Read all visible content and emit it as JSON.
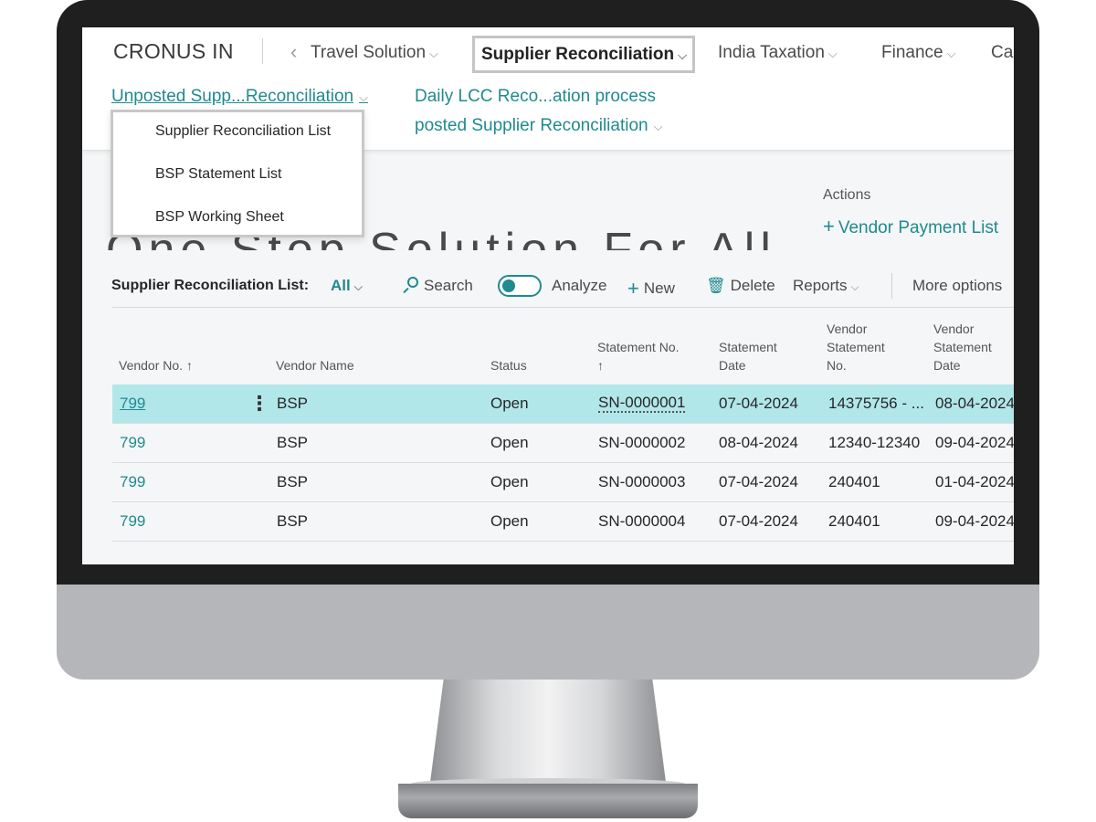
{
  "topnav": {
    "company": "CRONUS IN",
    "items": [
      {
        "label": "Travel Solution"
      },
      {
        "label": "Supplier Reconciliation"
      },
      {
        "label": "India Taxation"
      },
      {
        "label": "Finance"
      },
      {
        "label": "Ca"
      }
    ]
  },
  "subnav": {
    "links": [
      {
        "label": "Unposted Supp...Reconciliation"
      },
      {
        "label": "Daily LCC Reco...ation process"
      },
      {
        "label": "posted Supplier Reconciliation"
      }
    ]
  },
  "dropdown": {
    "items": [
      {
        "label": "Supplier Reconciliation List"
      },
      {
        "label": "BSP Statement List"
      },
      {
        "label": "BSP Working Sheet"
      }
    ]
  },
  "hero": {
    "text": "One Stop Solution For All"
  },
  "actions": {
    "title": "Actions",
    "vendor_payment": "Vendor Payment List"
  },
  "toolbar": {
    "title": "Supplier Reconciliation List:",
    "filter": "All",
    "search": "Search",
    "analyze": "Analyze",
    "new": "New",
    "delete": "Delete",
    "reports": "Reports",
    "more": "More options"
  },
  "table": {
    "columns": [
      {
        "line1": "",
        "line2": "",
        "line3": "Vendor No. ↑"
      },
      {
        "line1": "",
        "line2": "",
        "line3": "Vendor Name"
      },
      {
        "line1": "",
        "line2": "",
        "line3": "Status"
      },
      {
        "line1": "",
        "line2": "Statement No.",
        "line3": "↑"
      },
      {
        "line1": "",
        "line2": "Statement",
        "line3": "Date"
      },
      {
        "line1": "Vendor",
        "line2": "Statement",
        "line3": "No."
      },
      {
        "line1": "Vendor",
        "line2": "Statement",
        "line3": "Date"
      }
    ],
    "rows": [
      {
        "vendor_no": "799",
        "vendor_name": "BSP",
        "status": "Open",
        "statement_no": "SN-0000001",
        "statement_date": "07-04-2024",
        "vendor_statement_no": "14375756 - ...",
        "vendor_statement_date": "08-04-2024"
      },
      {
        "vendor_no": "799",
        "vendor_name": "BSP",
        "status": "Open",
        "statement_no": "SN-0000002",
        "statement_date": "08-04-2024",
        "vendor_statement_no": "12340-12340",
        "vendor_statement_date": "09-04-2024"
      },
      {
        "vendor_no": "799",
        "vendor_name": "BSP",
        "status": "Open",
        "statement_no": "SN-0000003",
        "statement_date": "07-04-2024",
        "vendor_statement_no": "240401",
        "vendor_statement_date": "01-04-2024"
      },
      {
        "vendor_no": "799",
        "vendor_name": "BSP",
        "status": "Open",
        "statement_no": "SN-0000004",
        "statement_date": "07-04-2024",
        "vendor_statement_no": "240401",
        "vendor_statement_date": "09-04-2024"
      }
    ]
  },
  "colors": {
    "accent": "#1f8a8f",
    "selected_row": "#b2e7ea",
    "bezel": "#1f1f1f",
    "chin": "#b5b6b9"
  }
}
